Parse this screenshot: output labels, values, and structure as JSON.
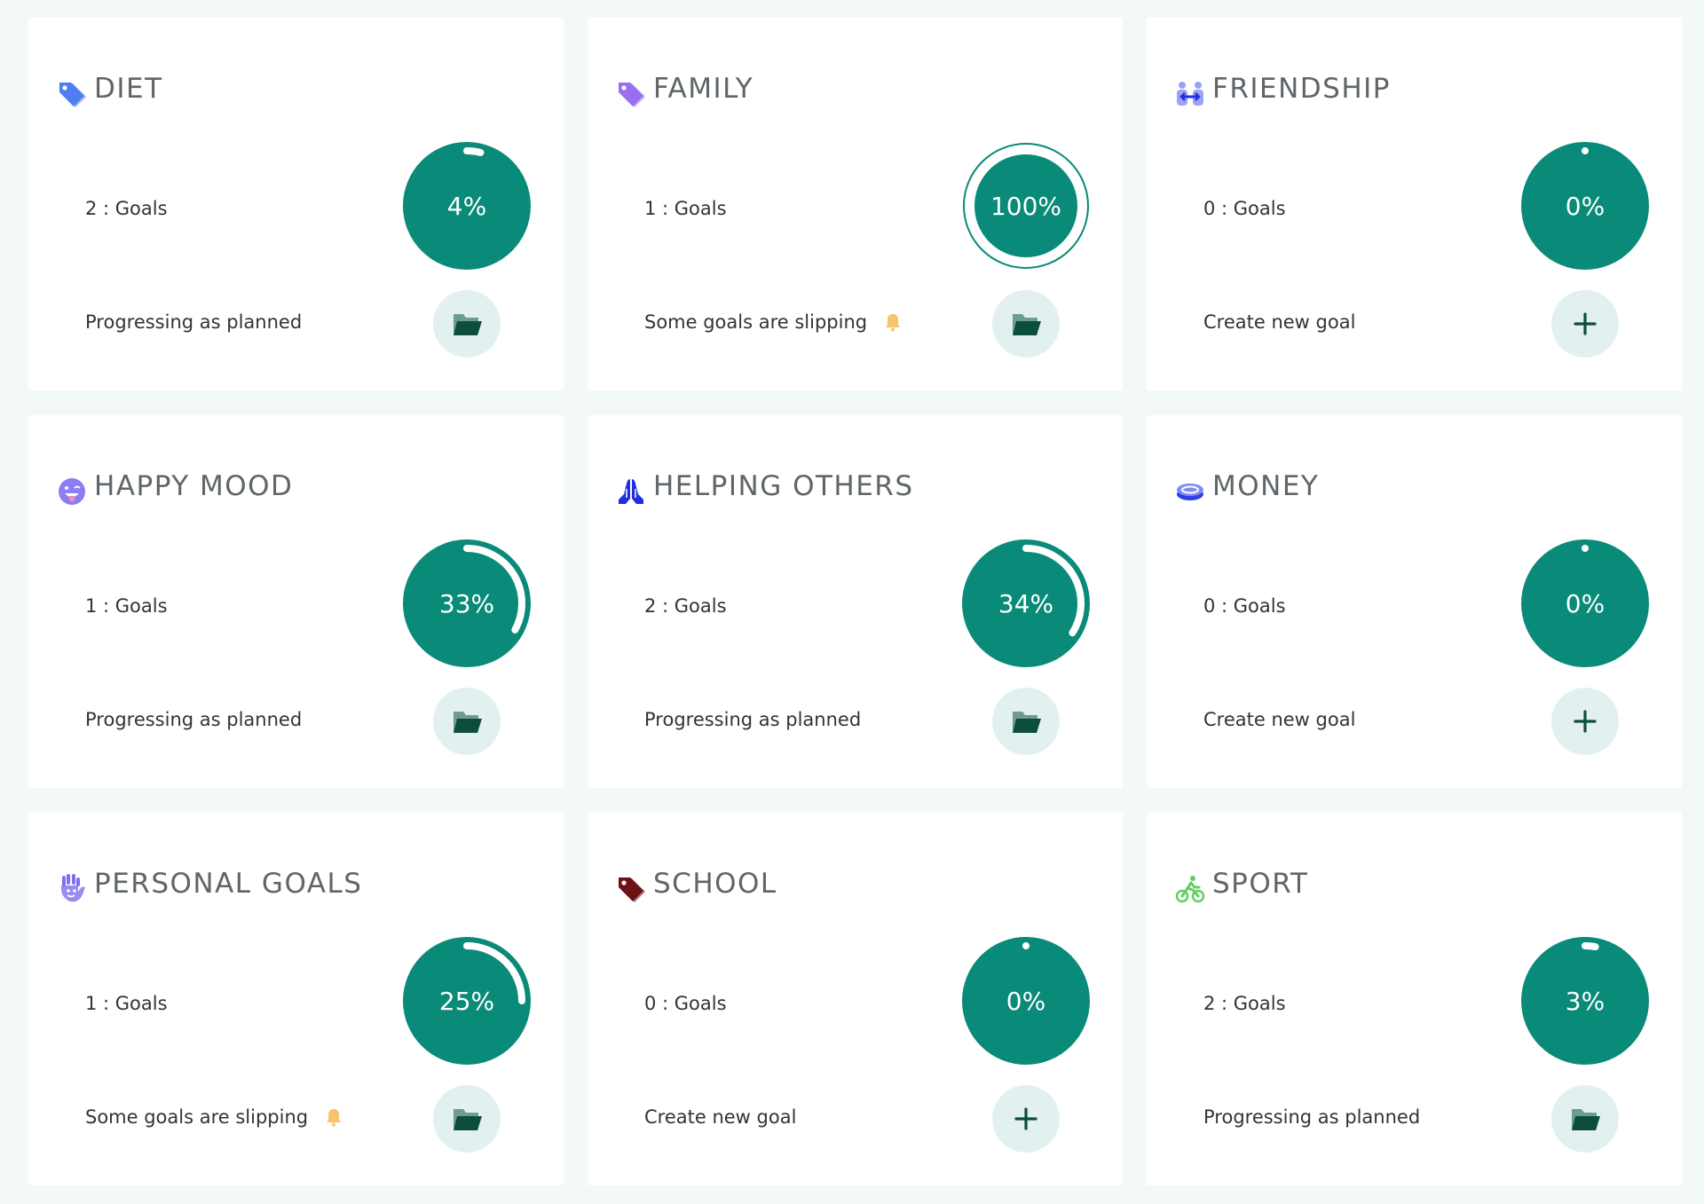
{
  "colors": {
    "ring_fill": "#0a8a78",
    "ring_track": "#ffffff",
    "action_bg": "#e2f1f0",
    "folder_dark": "#0d4d3c",
    "folder_light": "#6e9d90",
    "bell": "#f7c46a",
    "plus": "#0d4d3c"
  },
  "cards": [
    {
      "title": "DIET",
      "icon": "tag-icon",
      "icon_color": "#4f7df3",
      "goals": "2 : Goals",
      "percent": 4,
      "percent_label": "4%",
      "status": "Progressing as planned",
      "bell": false,
      "action": "folder"
    },
    {
      "title": "FAMILY",
      "icon": "tag-icon",
      "icon_color": "#9b6ef0",
      "goals": "1 : Goals",
      "percent": 100,
      "percent_label": "100%",
      "status": "Some goals are slipping",
      "bell": true,
      "action": "folder"
    },
    {
      "title": "FRIENDSHIP",
      "icon": "friends-icon",
      "icon_color": "#6f7cf2",
      "goals": "0 : Goals",
      "percent": 0,
      "percent_label": "0%",
      "status": "Create new goal",
      "bell": false,
      "action": "plus"
    },
    {
      "title": "HAPPY MOOD",
      "icon": "smiley-icon",
      "icon_color": "#8b7df2",
      "goals": "1 : Goals",
      "percent": 33,
      "percent_label": "33%",
      "status": "Progressing as planned",
      "bell": false,
      "action": "folder"
    },
    {
      "title": "HELPING OTHERS",
      "icon": "praying-hands-icon",
      "icon_color": "#1f2fe0",
      "goals": "2 : Goals",
      "percent": 34,
      "percent_label": "34%",
      "status": "Progressing as planned",
      "bell": false,
      "action": "folder"
    },
    {
      "title": "MONEY",
      "icon": "coin-icon",
      "icon_color": "#2f3fe6",
      "goals": "0 : Goals",
      "percent": 0,
      "percent_label": "0%",
      "status": "Create new goal",
      "bell": false,
      "action": "plus"
    },
    {
      "title": "PERSONAL GOALS",
      "icon": "hand-icon",
      "icon_color": "#7f6ef0",
      "goals": "1 : Goals",
      "percent": 25,
      "percent_label": "25%",
      "status": "Some goals are slipping",
      "bell": true,
      "action": "folder"
    },
    {
      "title": "SCHOOL",
      "icon": "tag-icon",
      "icon_color": "#6b1215",
      "goals": "0 : Goals",
      "percent": 0,
      "percent_label": "0%",
      "status": "Create new goal",
      "bell": false,
      "action": "plus"
    },
    {
      "title": "SPORT",
      "icon": "cyclist-icon",
      "icon_color": "#5fcf64",
      "goals": "2 : Goals",
      "percent": 3,
      "percent_label": "3%",
      "status": "Progressing as planned",
      "bell": false,
      "action": "folder"
    }
  ]
}
